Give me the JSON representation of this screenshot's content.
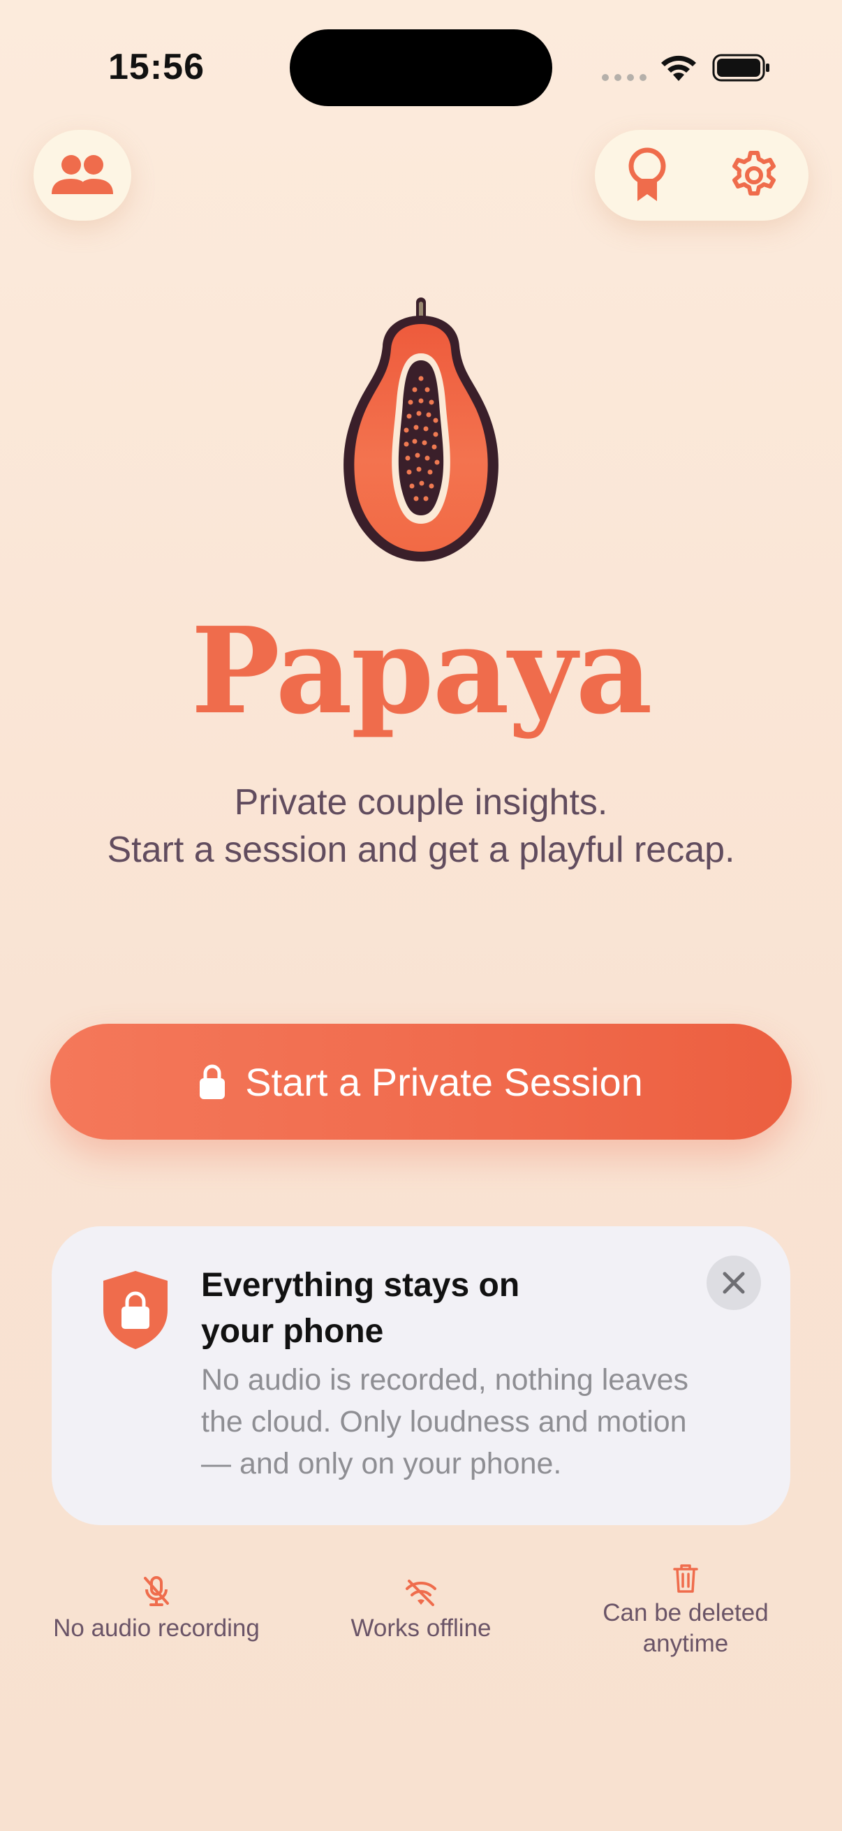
{
  "status_bar": {
    "time": "15:56"
  },
  "header": {
    "partner_icon": "people-icon",
    "achievements_icon": "award-ribbon-icon",
    "settings_icon": "gear-icon"
  },
  "app": {
    "title": "Papaya",
    "tagline_line1": "Private couple insights.",
    "tagline_line2": "Start a session and get a playful recap."
  },
  "cta": {
    "label": "Start a Private Session",
    "icon": "lock-icon"
  },
  "privacy_card": {
    "title_line1": "Everything stays on",
    "title_line2": "your phone",
    "body_line1": "No audio is recorded, nothing leaves",
    "body_line2": "the cloud. Only loudness and motion",
    "body_line3": "— and only on your phone."
  },
  "features": {
    "no_audio": {
      "label": "No audio recording",
      "icon": "mic-off-icon"
    },
    "offline": {
      "label": "Works offline",
      "icon": "wifi-off-icon"
    },
    "deletable": {
      "label_line1": "Can be deleted",
      "label_line2": "anytime",
      "icon": "trash-icon"
    }
  },
  "colors": {
    "accent": "#ef6c4c",
    "text_secondary": "#614c5e",
    "card_bg": "#f2f1f6"
  }
}
